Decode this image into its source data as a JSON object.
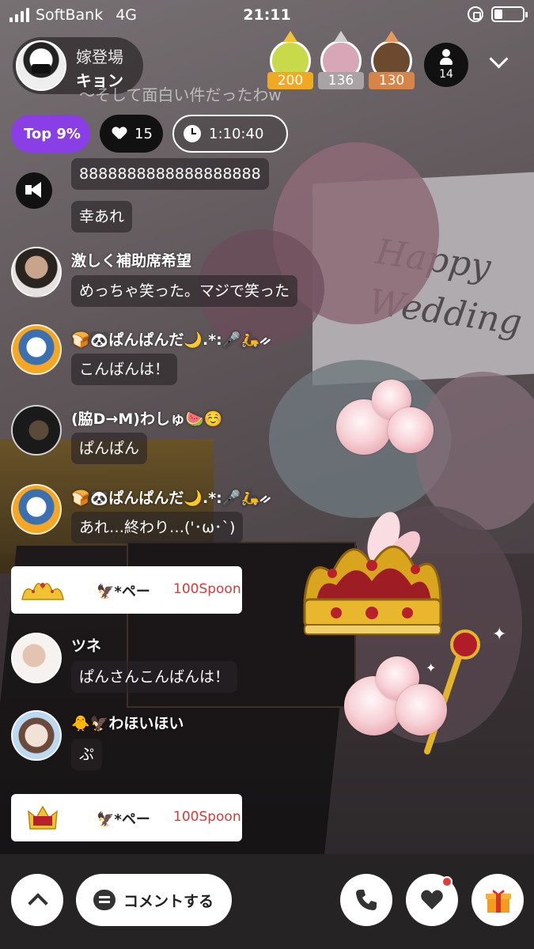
{
  "status_bar": {
    "carrier": "SoftBank",
    "network": "4G",
    "time": "21:11",
    "signal_bars": 4,
    "battery_level": 0.3
  },
  "host": {
    "subtitle": "嫁登場",
    "name": "キョン"
  },
  "ghost_comment": "〜そして面白い件だったわw",
  "top_rankers": [
    {
      "value": "200",
      "tag_color": "#f0a922",
      "face_color": "#c8d94a"
    },
    {
      "value": "136",
      "tag_color": "#a9a3a6",
      "face_color": "#d7a7b8"
    },
    {
      "value": "130",
      "tag_color": "#d68448",
      "face_color": "#6b4a2f"
    }
  ],
  "listeners_count": "14",
  "pills": {
    "top_label": "Top 9%",
    "likes": "15",
    "duration": "1:10:40"
  },
  "messages": [
    {
      "text": "8888888888888888888"
    },
    {
      "text": "幸あれ"
    },
    {
      "user": "激しく補助席希望",
      "text": "めっちゃ笑った。マジで笑った"
    },
    {
      "user": "🍞🐼ぱんぱんだ🌙.*:🎤🛵ᨀ",
      "text": "こんばんは！"
    },
    {
      "user": "(脇D→M)わしゅ🍉☺️",
      "text": "ぱんぱん"
    },
    {
      "user": "🍞🐼ぱんぱんだ🌙.*:🎤🛵ᨀ",
      "text": "あれ…終わり…('･ω･`)"
    },
    {
      "user": "ツネ",
      "text": "ぱんさんこんばんは！"
    },
    {
      "user": "🐥🦅わほいほい",
      "text": "ぷ"
    }
  ],
  "gifts": [
    {
      "sender": "🦅*ペー",
      "amount": "100Spoon",
      "icon": "tiara-icon"
    },
    {
      "sender": "🦅*ペー",
      "amount": "100Spoon",
      "icon": "crown-icon"
    }
  ],
  "bottom_bar": {
    "comment_label": "コメントする"
  },
  "colors": {
    "top_pill": "#8a3fe6",
    "spoon_amount": "#d83a3a"
  }
}
